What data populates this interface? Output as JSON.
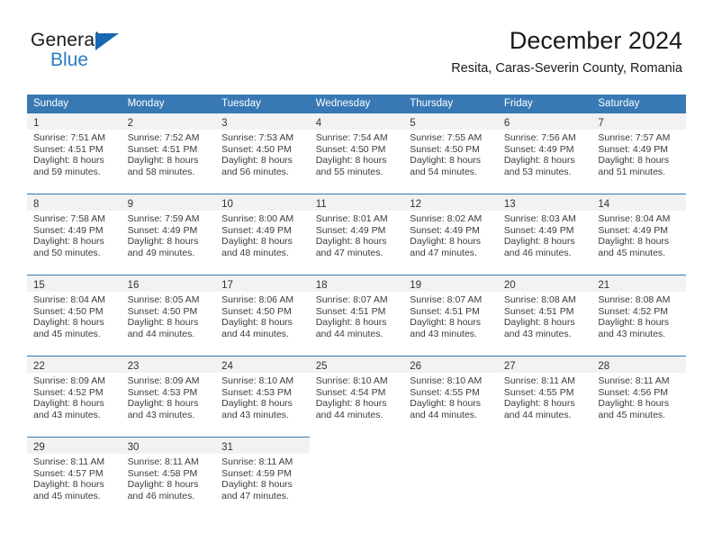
{
  "brand": {
    "name_part1": "General",
    "name_part2": "Blue"
  },
  "header": {
    "title": "December 2024",
    "subtitle": "Resita, Caras-Severin County, Romania",
    "accent_color": "#3878b4",
    "band_color": "#f2f2f2"
  },
  "weekdays": [
    "Sunday",
    "Monday",
    "Tuesday",
    "Wednesday",
    "Thursday",
    "Friday",
    "Saturday"
  ],
  "days": [
    {
      "n": "1",
      "sunrise": "Sunrise: 7:51 AM",
      "sunset": "Sunset: 4:51 PM",
      "daylight1": "Daylight: 8 hours",
      "daylight2": "and 59 minutes."
    },
    {
      "n": "2",
      "sunrise": "Sunrise: 7:52 AM",
      "sunset": "Sunset: 4:51 PM",
      "daylight1": "Daylight: 8 hours",
      "daylight2": "and 58 minutes."
    },
    {
      "n": "3",
      "sunrise": "Sunrise: 7:53 AM",
      "sunset": "Sunset: 4:50 PM",
      "daylight1": "Daylight: 8 hours",
      "daylight2": "and 56 minutes."
    },
    {
      "n": "4",
      "sunrise": "Sunrise: 7:54 AM",
      "sunset": "Sunset: 4:50 PM",
      "daylight1": "Daylight: 8 hours",
      "daylight2": "and 55 minutes."
    },
    {
      "n": "5",
      "sunrise": "Sunrise: 7:55 AM",
      "sunset": "Sunset: 4:50 PM",
      "daylight1": "Daylight: 8 hours",
      "daylight2": "and 54 minutes."
    },
    {
      "n": "6",
      "sunrise": "Sunrise: 7:56 AM",
      "sunset": "Sunset: 4:49 PM",
      "daylight1": "Daylight: 8 hours",
      "daylight2": "and 53 minutes."
    },
    {
      "n": "7",
      "sunrise": "Sunrise: 7:57 AM",
      "sunset": "Sunset: 4:49 PM",
      "daylight1": "Daylight: 8 hours",
      "daylight2": "and 51 minutes."
    },
    {
      "n": "8",
      "sunrise": "Sunrise: 7:58 AM",
      "sunset": "Sunset: 4:49 PM",
      "daylight1": "Daylight: 8 hours",
      "daylight2": "and 50 minutes."
    },
    {
      "n": "9",
      "sunrise": "Sunrise: 7:59 AM",
      "sunset": "Sunset: 4:49 PM",
      "daylight1": "Daylight: 8 hours",
      "daylight2": "and 49 minutes."
    },
    {
      "n": "10",
      "sunrise": "Sunrise: 8:00 AM",
      "sunset": "Sunset: 4:49 PM",
      "daylight1": "Daylight: 8 hours",
      "daylight2": "and 48 minutes."
    },
    {
      "n": "11",
      "sunrise": "Sunrise: 8:01 AM",
      "sunset": "Sunset: 4:49 PM",
      "daylight1": "Daylight: 8 hours",
      "daylight2": "and 47 minutes."
    },
    {
      "n": "12",
      "sunrise": "Sunrise: 8:02 AM",
      "sunset": "Sunset: 4:49 PM",
      "daylight1": "Daylight: 8 hours",
      "daylight2": "and 47 minutes."
    },
    {
      "n": "13",
      "sunrise": "Sunrise: 8:03 AM",
      "sunset": "Sunset: 4:49 PM",
      "daylight1": "Daylight: 8 hours",
      "daylight2": "and 46 minutes."
    },
    {
      "n": "14",
      "sunrise": "Sunrise: 8:04 AM",
      "sunset": "Sunset: 4:49 PM",
      "daylight1": "Daylight: 8 hours",
      "daylight2": "and 45 minutes."
    },
    {
      "n": "15",
      "sunrise": "Sunrise: 8:04 AM",
      "sunset": "Sunset: 4:50 PM",
      "daylight1": "Daylight: 8 hours",
      "daylight2": "and 45 minutes."
    },
    {
      "n": "16",
      "sunrise": "Sunrise: 8:05 AM",
      "sunset": "Sunset: 4:50 PM",
      "daylight1": "Daylight: 8 hours",
      "daylight2": "and 44 minutes."
    },
    {
      "n": "17",
      "sunrise": "Sunrise: 8:06 AM",
      "sunset": "Sunset: 4:50 PM",
      "daylight1": "Daylight: 8 hours",
      "daylight2": "and 44 minutes."
    },
    {
      "n": "18",
      "sunrise": "Sunrise: 8:07 AM",
      "sunset": "Sunset: 4:51 PM",
      "daylight1": "Daylight: 8 hours",
      "daylight2": "and 44 minutes."
    },
    {
      "n": "19",
      "sunrise": "Sunrise: 8:07 AM",
      "sunset": "Sunset: 4:51 PM",
      "daylight1": "Daylight: 8 hours",
      "daylight2": "and 43 minutes."
    },
    {
      "n": "20",
      "sunrise": "Sunrise: 8:08 AM",
      "sunset": "Sunset: 4:51 PM",
      "daylight1": "Daylight: 8 hours",
      "daylight2": "and 43 minutes."
    },
    {
      "n": "21",
      "sunrise": "Sunrise: 8:08 AM",
      "sunset": "Sunset: 4:52 PM",
      "daylight1": "Daylight: 8 hours",
      "daylight2": "and 43 minutes."
    },
    {
      "n": "22",
      "sunrise": "Sunrise: 8:09 AM",
      "sunset": "Sunset: 4:52 PM",
      "daylight1": "Daylight: 8 hours",
      "daylight2": "and 43 minutes."
    },
    {
      "n": "23",
      "sunrise": "Sunrise: 8:09 AM",
      "sunset": "Sunset: 4:53 PM",
      "daylight1": "Daylight: 8 hours",
      "daylight2": "and 43 minutes."
    },
    {
      "n": "24",
      "sunrise": "Sunrise: 8:10 AM",
      "sunset": "Sunset: 4:53 PM",
      "daylight1": "Daylight: 8 hours",
      "daylight2": "and 43 minutes."
    },
    {
      "n": "25",
      "sunrise": "Sunrise: 8:10 AM",
      "sunset": "Sunset: 4:54 PM",
      "daylight1": "Daylight: 8 hours",
      "daylight2": "and 44 minutes."
    },
    {
      "n": "26",
      "sunrise": "Sunrise: 8:10 AM",
      "sunset": "Sunset: 4:55 PM",
      "daylight1": "Daylight: 8 hours",
      "daylight2": "and 44 minutes."
    },
    {
      "n": "27",
      "sunrise": "Sunrise: 8:11 AM",
      "sunset": "Sunset: 4:55 PM",
      "daylight1": "Daylight: 8 hours",
      "daylight2": "and 44 minutes."
    },
    {
      "n": "28",
      "sunrise": "Sunrise: 8:11 AM",
      "sunset": "Sunset: 4:56 PM",
      "daylight1": "Daylight: 8 hours",
      "daylight2": "and 45 minutes."
    },
    {
      "n": "29",
      "sunrise": "Sunrise: 8:11 AM",
      "sunset": "Sunset: 4:57 PM",
      "daylight1": "Daylight: 8 hours",
      "daylight2": "and 45 minutes."
    },
    {
      "n": "30",
      "sunrise": "Sunrise: 8:11 AM",
      "sunset": "Sunset: 4:58 PM",
      "daylight1": "Daylight: 8 hours",
      "daylight2": "and 46 minutes."
    },
    {
      "n": "31",
      "sunrise": "Sunrise: 8:11 AM",
      "sunset": "Sunset: 4:59 PM",
      "daylight1": "Daylight: 8 hours",
      "daylight2": "and 47 minutes."
    }
  ],
  "grid": {
    "first_day_column": 0,
    "rows": 5,
    "columns": 7
  }
}
